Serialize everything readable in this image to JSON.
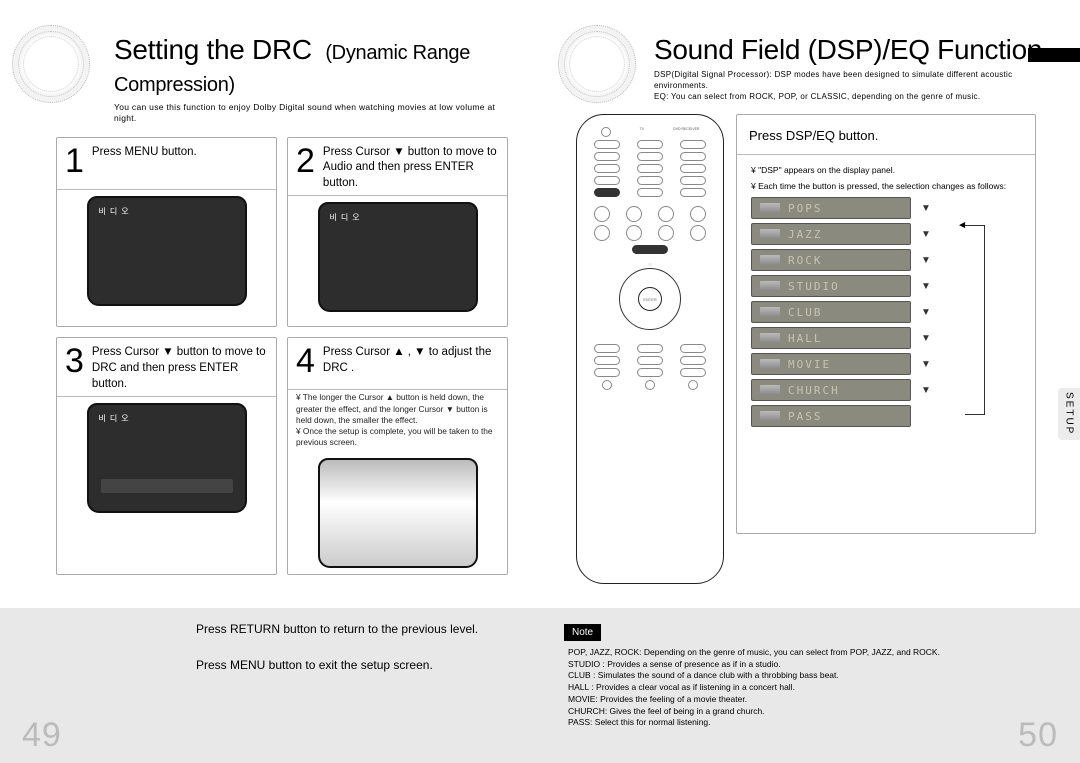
{
  "left": {
    "title_main": "Setting the DRC",
    "title_sub": "(Dynamic Range Compression)",
    "intro": "You can use this function to enjoy Dolby Digital sound when watching movies at low volume at night.",
    "steps": [
      {
        "num": "1",
        "text": "Press MENU button.",
        "tv_label": "비디오"
      },
      {
        "num": "2",
        "text": "Press Cursor ▼ button to move to  Audio  and then press ENTER button.",
        "tv_label": "비디오"
      },
      {
        "num": "3",
        "text": "Press Cursor ▼ button to move to  DRC  and then press ENTER button.",
        "tv_label": "비디오"
      },
      {
        "num": "4",
        "text": "Press Cursor  ▲ , ▼  to adjust the  DRC .",
        "notes": [
          "¥ The longer the Cursor ▲ button is held down, the greater the effect, and the longer Cursor ▼ button is held down, the smaller the effect.",
          "¥ Once the setup is complete, you will be taken to the previous screen."
        ]
      }
    ],
    "footer_return": "Press RETURN button to return to the previous level.",
    "footer_menu": "Press MENU button to exit the setup screen.",
    "pagenum": "49"
  },
  "right": {
    "title": "Sound Field (DSP)/EQ Function",
    "intro": "DSP(Digital Signal Processor): DSP modes have been designed to simulate different acoustic environments.\nEQ: You can select from ROCK, POP, or CLASSIC, depending on the genre of music.",
    "card_head": "Press DSP/EQ button.",
    "bullets": [
      "¥ \"DSP\" appears on the display panel.",
      "¥ Each time the button is pressed, the selection changes as follows:"
    ],
    "modes": [
      "POPS",
      "JAZZ",
      "ROCK",
      "STUDIO",
      "CLUB",
      "HALL",
      "MOVIE",
      "CHURCH",
      "PASS"
    ],
    "note_label": "Note",
    "descs": [
      "POP, JAZZ, ROCK:  Depending on the genre of music, you can select from POP, JAZZ, and ROCK.",
      "STUDIO : Provides a sense of presence as if in a studio.",
      "CLUB : Simulates the sound of a dance club with a throbbing bass beat.",
      "HALL : Provides a clear vocal as if listening in a concert hall.",
      "MOVIE: Provides the feeling of a movie theater.",
      "CHURCH: Gives the feel of being in a grand church.",
      "PASS: Select this for normal listening."
    ],
    "sidetab": "SETUP",
    "pagenum": "50",
    "remote": {
      "highlight": "DSP/EQ",
      "enter": "ENTER"
    }
  }
}
